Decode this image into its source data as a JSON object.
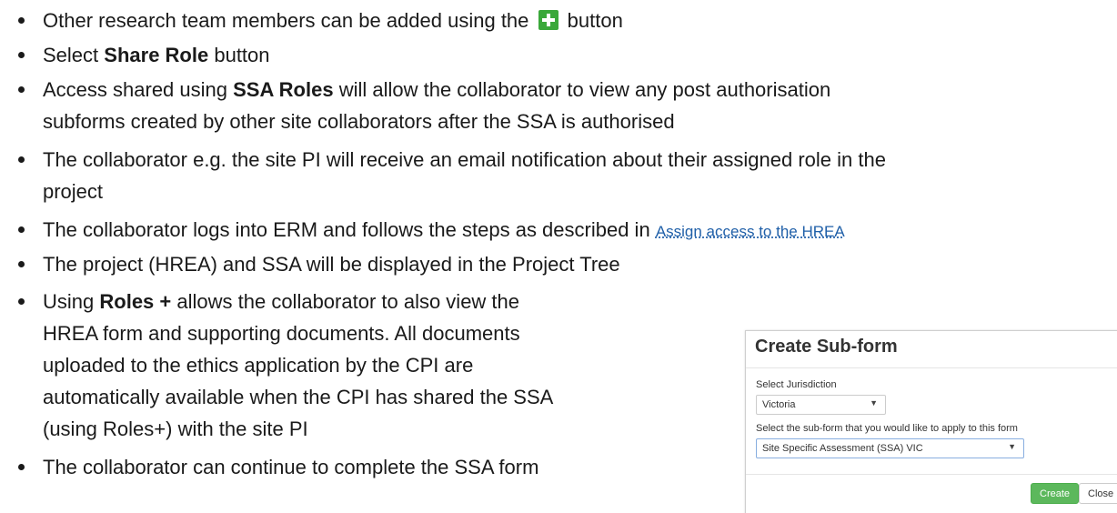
{
  "bullets": [
    {
      "text_before": "Other research team members can be added using the",
      "icon": "green-plus-icon",
      "text_after": "button"
    },
    {
      "text_before": "Select",
      "bold": "Share Role",
      "text_after": "button"
    },
    {
      "line1_before": "Access shared using",
      "bold": "SSA Roles",
      "line1_after": "will allow the collaborator to view any post authorisation",
      "line2": "subforms created by other site collaborators after the SSA is authorised"
    },
    {
      "line1": "The collaborator e.g. the site PI will receive an email notification about their assigned role in the",
      "line2": "project"
    },
    {
      "text": "The collaborator logs into ERM and follows the steps as described in",
      "link": "Assign access to the HREA"
    },
    {
      "text": "The project (HREA) and SSA will be displayed in the Project Tree"
    },
    {
      "line1_before": "Using",
      "bold": "Roles +",
      "line1_after": "allows the collaborator to also view the",
      "line2": "HREA form and supporting documents. All documents",
      "line3": "uploaded to the ethics application by the CPI are",
      "line4": "automatically available when the CPI has shared the SSA",
      "line5": "(using Roles+) with the site PI"
    },
    {
      "text": "The collaborator can continue to complete the SSA form"
    }
  ],
  "modal": {
    "title": "Create Sub-form",
    "jurisdiction_label": "Select Jurisdiction",
    "jurisdiction_value": "Victoria",
    "subform_label": "Select the sub-form that you would like to apply to this form",
    "subform_value": "Site Specific Assessment (SSA) VIC",
    "create_label": "Create",
    "close_label": "Close",
    "create_color": "#5cb85c"
  }
}
